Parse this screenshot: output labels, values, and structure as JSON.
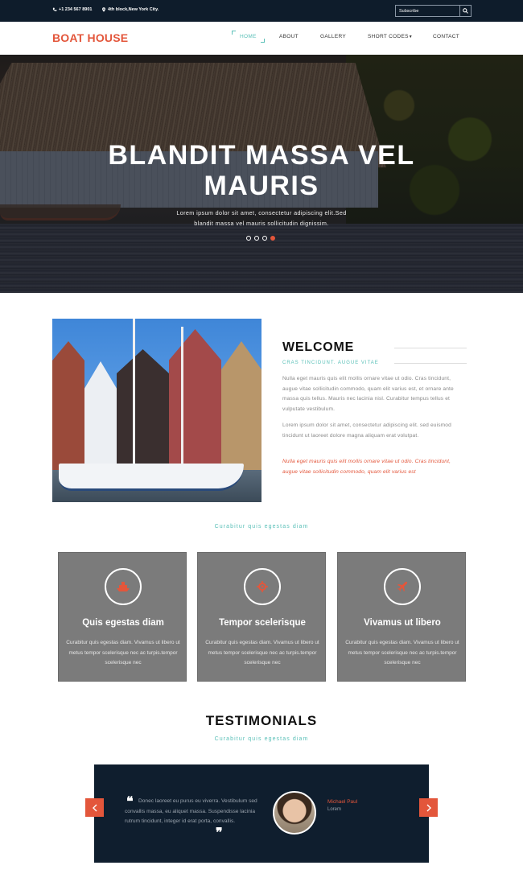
{
  "topbar": {
    "phone": "+1 234 567 8901",
    "address": "4th block,New York City.",
    "subscribe_placeholder": "Subscribe"
  },
  "nav": {
    "logo": "BOAT HOUSE",
    "links": [
      "HOME",
      "ABOUT",
      "GALLERY",
      "SHORT CODES",
      "CONTACT"
    ]
  },
  "hero": {
    "title_line1": "BLANDIT MASSA VEL",
    "title_line2": "MAURIS",
    "subtitle_line1": "Lorem ipsum dolor sit amet, consectetur adipiscing elit.Sed",
    "subtitle_line2": "blandit massa vel mauris sollicitudin dignissim."
  },
  "welcome": {
    "title": "WELCOME",
    "tagline": "Cras tincidunt. augue vitae",
    "para1": "Nulla eget mauris quis elit mollis ornare vitae ut odio. Cras tincidunt, augue vitae sollicitudin commodo, quam elit varius est, et ornare ante massa quis tellus. Mauris nec lacinia nisl. Curabitur tempus tellus et vulputate vestibulum.",
    "para2": "Lorem ipsum dolor sit amet, consectetur adipiscing elit. sed euismod tincidunt ut laoreet dolore magna aliquam erat volutpat.",
    "para3": "Nulla eget mauris quis elit mollis ornare vitae ut odio. Cras tincidunt, augue vitae sollicitudin commodo, quam elit varius est"
  },
  "services": {
    "subtitle": "Curabitur quis egestas diam",
    "cards": [
      {
        "title": "Quis egestas diam",
        "text": "Curabitur quis egestas diam. Vivamus ut libero ut metus tempor scelerisque nec ac turpis.tempor scelerisque nec",
        "icon": "ship-icon"
      },
      {
        "title": "Tempor scelerisque",
        "text": "Curabitur quis egestas diam. Vivamus ut libero ut metus tempor scelerisque nec ac turpis.tempor scelerisque nec",
        "icon": "helm-icon"
      },
      {
        "title": "Vivamus ut libero",
        "text": "Curabitur quis egestas diam. Vivamus ut libero ut metus tempor scelerisque nec ac turpis.tempor scelerisque nec",
        "icon": "plane-icon"
      }
    ]
  },
  "testimonials": {
    "title": "TESTIMONIALS",
    "subtitle": "Curabitur quis egestas diam",
    "quote": "Donec laoreet eu purus eu viverra. Vestibulum sed convallis massa, eu aliquet massa. Suspendisse lacinia rutrum tincidunt, integer id erat porta, convallis.",
    "name": "Michael Paul",
    "role": "Lorem"
  },
  "colors": {
    "accent": "#e3563b",
    "teal": "#5bc0b8",
    "dark": "#0e1c2b"
  }
}
